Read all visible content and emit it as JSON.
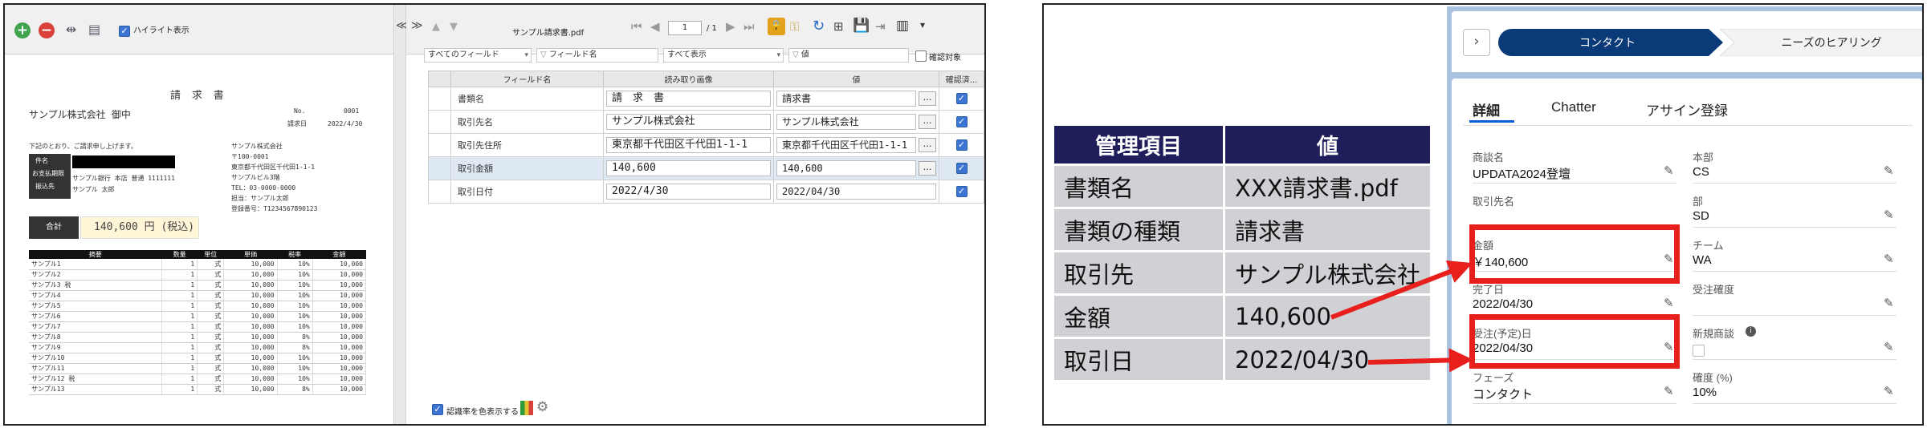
{
  "left": {
    "toolbar": {
      "highlight_label": "ハイライト表示",
      "collapse_glyph": "≪",
      "expand_glyph": "≫"
    },
    "viewer": {
      "filename": "サンプル請求書.pdf",
      "page_current": "1",
      "page_total": "/ 1"
    },
    "invoice": {
      "title": "請 求 書",
      "addressee": "サンプル株式会社 御中",
      "no_label": "No.",
      "no_value": "0001",
      "date_label": "請求日",
      "date_value": "2022/4/30",
      "intro": "下記のとおり、ご請求申し上げます。",
      "issuer": [
        "サンプル株式会社",
        "〒100-0001",
        "東京都千代田区千代田1-1-1",
        "サンプルビル3階",
        "TEL：03-0000-0000",
        "担当：サンプル太郎",
        "登録番号：T1234567890123"
      ],
      "info_labels": [
        "件名",
        "お支払期限",
        "振込先"
      ],
      "info_values": [
        "",
        "",
        "サンプル銀行 本店 普通 1111111",
        "サンプル 太郎"
      ],
      "total_label": "合計",
      "total_value": "140,600 円 (税込)",
      "items_headers": [
        "摘要",
        "数量",
        "単位",
        "単価",
        "税率",
        "金額"
      ],
      "items": [
        [
          "サンプル1",
          "1",
          "式",
          "10,000",
          "10%",
          "10,000"
        ],
        [
          "サンプル2",
          "1",
          "式",
          "10,000",
          "10%",
          "10,000"
        ],
        [
          "サンプル3 税",
          "1",
          "式",
          "10,000",
          "10%",
          "10,000"
        ],
        [
          "サンプル4",
          "1",
          "式",
          "10,000",
          "10%",
          "10,000"
        ],
        [
          "サンプル5",
          "1",
          "式",
          "10,000",
          "10%",
          "10,000"
        ],
        [
          "サンプル6",
          "1",
          "式",
          "10,000",
          "10%",
          "10,000"
        ],
        [
          "サンプル7",
          "1",
          "式",
          "10,000",
          "10%",
          "10,000"
        ],
        [
          "サンプル8",
          "1",
          "式",
          "10,000",
          "8%",
          "10,000"
        ],
        [
          "サンプル9",
          "1",
          "式",
          "10,000",
          "8%",
          "10,000"
        ],
        [
          "サンプル10",
          "1",
          "式",
          "10,000",
          "10%",
          "10,000"
        ],
        [
          "サンプル11",
          "1",
          "式",
          "10,000",
          "10%",
          "10,000"
        ],
        [
          "サンプル12 税",
          "1",
          "式",
          "10,000",
          "10%",
          "10,000"
        ],
        [
          "サンプル13",
          "1",
          "式",
          "10,000",
          "8%",
          "10,000"
        ]
      ]
    },
    "filters": {
      "field": "すべてのフィールド",
      "field_name": "フィールド名",
      "display": "すべて表示",
      "value": "値",
      "confirm": "確認対象"
    },
    "grid": {
      "headers": [
        "フィールド名",
        "読み取り画像",
        "値",
        "確認済..."
      ],
      "rows": [
        {
          "field": "書類名",
          "image": "請　求　書",
          "value": "請求書"
        },
        {
          "field": "取引先名",
          "image": "サンプル株式会社",
          "value": "サンプル株式会社"
        },
        {
          "field": "取引先住所",
          "image": "東京都千代田区千代田1-1-1",
          "value": "東京都千代田区千代田1-1-1"
        },
        {
          "field": "取引金額",
          "image": "140,600",
          "value": "140,600"
        },
        {
          "field": "取引日付",
          "image": "2022/4/30",
          "value": "2022/04/30"
        }
      ]
    },
    "footer": {
      "check_label": "認識率を色表示する"
    }
  },
  "right": {
    "table": {
      "headers": [
        "管理項目",
        "値"
      ],
      "rows": [
        [
          "書類名",
          "XXX請求書.pdf"
        ],
        [
          "書類の種類",
          "請求書"
        ],
        [
          "取引先",
          "サンプル株式会社"
        ],
        [
          "金額",
          "140,600"
        ],
        [
          "取引日",
          "2022/04/30"
        ]
      ]
    },
    "salesforce": {
      "path_active": "コンタクト",
      "path_next": "ニーズのヒアリング",
      "tabs": [
        "詳細",
        "Chatter",
        "アサイン登録"
      ],
      "left_fields": [
        {
          "label": "商談名",
          "value": "UPDATA2024登壇"
        },
        {
          "label": "取引先名",
          "value": ""
        },
        {
          "label": "金額",
          "value": "￥140,600"
        },
        {
          "label": "完了日",
          "value": "2022/04/30"
        },
        {
          "label": "受注(予定)日",
          "value": "2022/04/30"
        },
        {
          "label": "フェーズ",
          "value": "コンタクト"
        }
      ],
      "right_fields": [
        {
          "label": "本部",
          "value": "CS"
        },
        {
          "label": "部",
          "value": "SD"
        },
        {
          "label": "チーム",
          "value": "WA"
        },
        {
          "label": "受注確度",
          "value": ""
        },
        {
          "label": "新規商談",
          "value": ""
        },
        {
          "label": "確度 (%)",
          "value": "10%"
        }
      ]
    },
    "colors": {
      "header_navy": "#1f1d5a",
      "cell_gray": "#d0d1d4",
      "highlight_red": "#e8201d",
      "sf_path_active": "#0b3a78",
      "sf_background": "#a9c3e0"
    }
  }
}
